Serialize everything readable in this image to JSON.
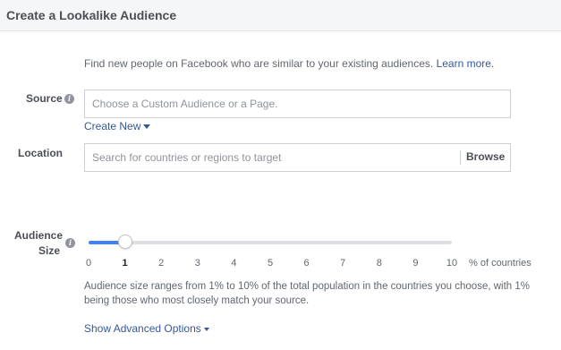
{
  "header": {
    "title": "Create a Lookalike Audience"
  },
  "intro": {
    "text": "Find new people on Facebook who are similar to your existing audiences.",
    "link": "Learn more."
  },
  "source": {
    "label": "Source",
    "info_icon": "info-icon",
    "placeholder": "Choose a Custom Audience or a Page.",
    "create_new": "Create New"
  },
  "location": {
    "label": "Location",
    "placeholder": "Search for countries or regions to target",
    "browse": "Browse"
  },
  "audience_size": {
    "label_line1": "Audience",
    "label_line2": "Size",
    "info_icon": "info-icon",
    "ticks": [
      "0",
      "1",
      "2",
      "3",
      "4",
      "5",
      "6",
      "7",
      "8",
      "9",
      "10"
    ],
    "min": 0,
    "max": 10,
    "value": 1,
    "unit": "% of countries",
    "help": "Audience size ranges from 1% to 10% of the total population in the countries you choose, with 1% being those who most closely match your source."
  },
  "advanced": {
    "label": "Show Advanced Options"
  },
  "colors": {
    "accent": "#4080ff",
    "link": "#365899",
    "track": "#dddfe2"
  }
}
